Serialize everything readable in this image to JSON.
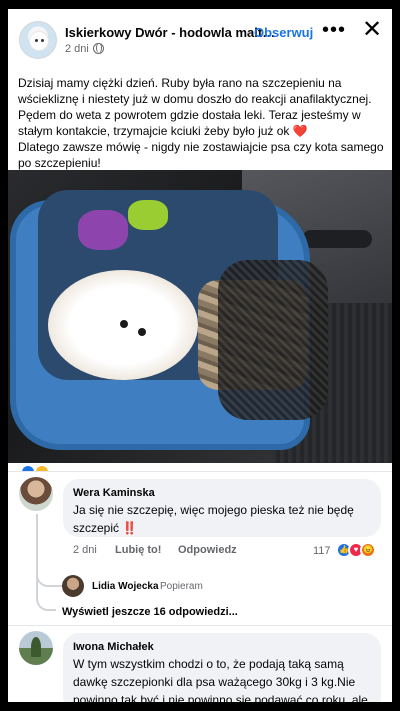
{
  "post": {
    "page_name": "Iskierkowy Dwór - hodowla malt…",
    "separator": "·",
    "follow_label": "Obserwuj",
    "time": "2 dni",
    "more_icon": "more-horizontal-icon",
    "close_icon": "close-icon",
    "text": [
      "Dzisiaj mamy ciężki dzień. Ruby była rano na szczepieniu na wściekliznę i niestety już w domu doszło do reakcji anafilaktycznej. Pędem do weta z powrotem gdzie dostała leki. Teraz jesteśmy w stałym kontakcie, trzymajcie kciuki żeby było już ok",
      "Dlatego zawsze mówię - nigdy nie zostawiajcie psa czy kota samego po szczepieniu!"
    ],
    "heart_emoji": "❤️"
  },
  "comments": [
    {
      "author": "Wera Kaminska",
      "text": "Ja się nie szczepię, więc mojego pieska też nie będę szczepić",
      "emoji": "‼️",
      "time": "2 dni",
      "like_label": "Lubię to!",
      "reply_label": "Odpowiedz",
      "reaction_count": "117",
      "reactions": [
        "like",
        "love",
        "angry"
      ],
      "reply": {
        "author": "Lidia Wojecka",
        "action": "Popieram"
      },
      "more_replies": "Wyświetl jeszcze 16 odpowiedzi..."
    },
    {
      "author": "Iwona Michałek",
      "text": "W tym wszystkim chodzi o to, że podają taką samą dawkę szczepionki dla psa ważącego 30kg i 3 kg.Nie powinno tak być i nie powinno się podawać co roku, ale koncerny farmaceutyczne muszą zarobić."
    }
  ],
  "colors": {
    "accent": "#1b74e4",
    "heart": "#e41e3f",
    "bubble": "#f0f2f5"
  }
}
